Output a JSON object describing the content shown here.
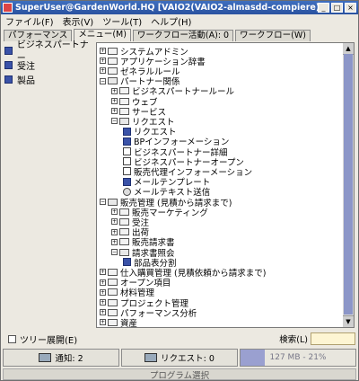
{
  "window": {
    "title": "SuperUser@GardenWorld.HQ [VAIO2(VAIO2-almasdd-compiere)]",
    "buttons": [
      "_",
      "□",
      "×"
    ]
  },
  "menu": [
    "ファイル(F)",
    "表示(V)",
    "ツール(T)",
    "ヘルプ(H)"
  ],
  "tabs": [
    "パフォーマンス",
    "メニュー(M)",
    "ワークフロー活動(A): 0",
    "ワークフロー(W)"
  ],
  "active_tab": 1,
  "favorites": [
    "ビジネスパートナー",
    "受注",
    "製品"
  ],
  "tree": [
    {
      "d": 0,
      "t": "f",
      "label": "システムアドミン"
    },
    {
      "d": 0,
      "t": "f",
      "label": "アプリケーション辞書"
    },
    {
      "d": 0,
      "t": "f",
      "label": "ゼネラルルール"
    },
    {
      "d": 0,
      "t": "o",
      "label": "パートナー関係"
    },
    {
      "d": 1,
      "t": "f",
      "label": "ビジネスパートナールール"
    },
    {
      "d": 1,
      "t": "f",
      "label": "ウェブ"
    },
    {
      "d": 1,
      "t": "f",
      "label": "サービス"
    },
    {
      "d": 1,
      "t": "o",
      "label": "リクエスト"
    },
    {
      "d": 2,
      "t": "w",
      "label": "リクエスト"
    },
    {
      "d": 2,
      "t": "w",
      "label": "BPインフォーメーション"
    },
    {
      "d": 2,
      "t": "d",
      "label": "ビジネスパートナー詳細"
    },
    {
      "d": 2,
      "t": "d",
      "label": "ビジネスパートナーオープン"
    },
    {
      "d": 2,
      "t": "d",
      "label": "販売代理インフォーメーション"
    },
    {
      "d": 2,
      "t": "w",
      "label": "メールテンプレート"
    },
    {
      "d": 2,
      "t": "g",
      "label": "メールテキスト送信"
    },
    {
      "d": 0,
      "t": "o",
      "label": "販売管理 (見積から請求まで)"
    },
    {
      "d": 1,
      "t": "f",
      "label": "販売マーケティング"
    },
    {
      "d": 1,
      "t": "f",
      "label": "受注"
    },
    {
      "d": 1,
      "t": "f",
      "label": "出荷"
    },
    {
      "d": 1,
      "t": "f",
      "label": "販売請求書"
    },
    {
      "d": 1,
      "t": "o",
      "label": "請求書照会"
    },
    {
      "d": 2,
      "t": "w",
      "label": "部品表分割"
    },
    {
      "d": 0,
      "t": "f",
      "label": "仕入購買管理 (見積依頼から請求まで)"
    },
    {
      "d": 0,
      "t": "f",
      "label": "オープン項目"
    },
    {
      "d": 0,
      "t": "f",
      "label": "材料管理"
    },
    {
      "d": 0,
      "t": "f",
      "label": "プロジェクト管理"
    },
    {
      "d": 0,
      "t": "f",
      "label": "パフォーマンス分析"
    },
    {
      "d": 0,
      "t": "f",
      "label": "資産"
    }
  ],
  "bottom": {
    "expand_label": "ツリー展開(E)",
    "search_label": "検索(L)",
    "search_value": ""
  },
  "status": {
    "notice": "通知: 2",
    "request": "リクエスト: 0",
    "memory": "127 MB - 21%",
    "memory_pct": 21
  },
  "footer": "プログラム選択"
}
